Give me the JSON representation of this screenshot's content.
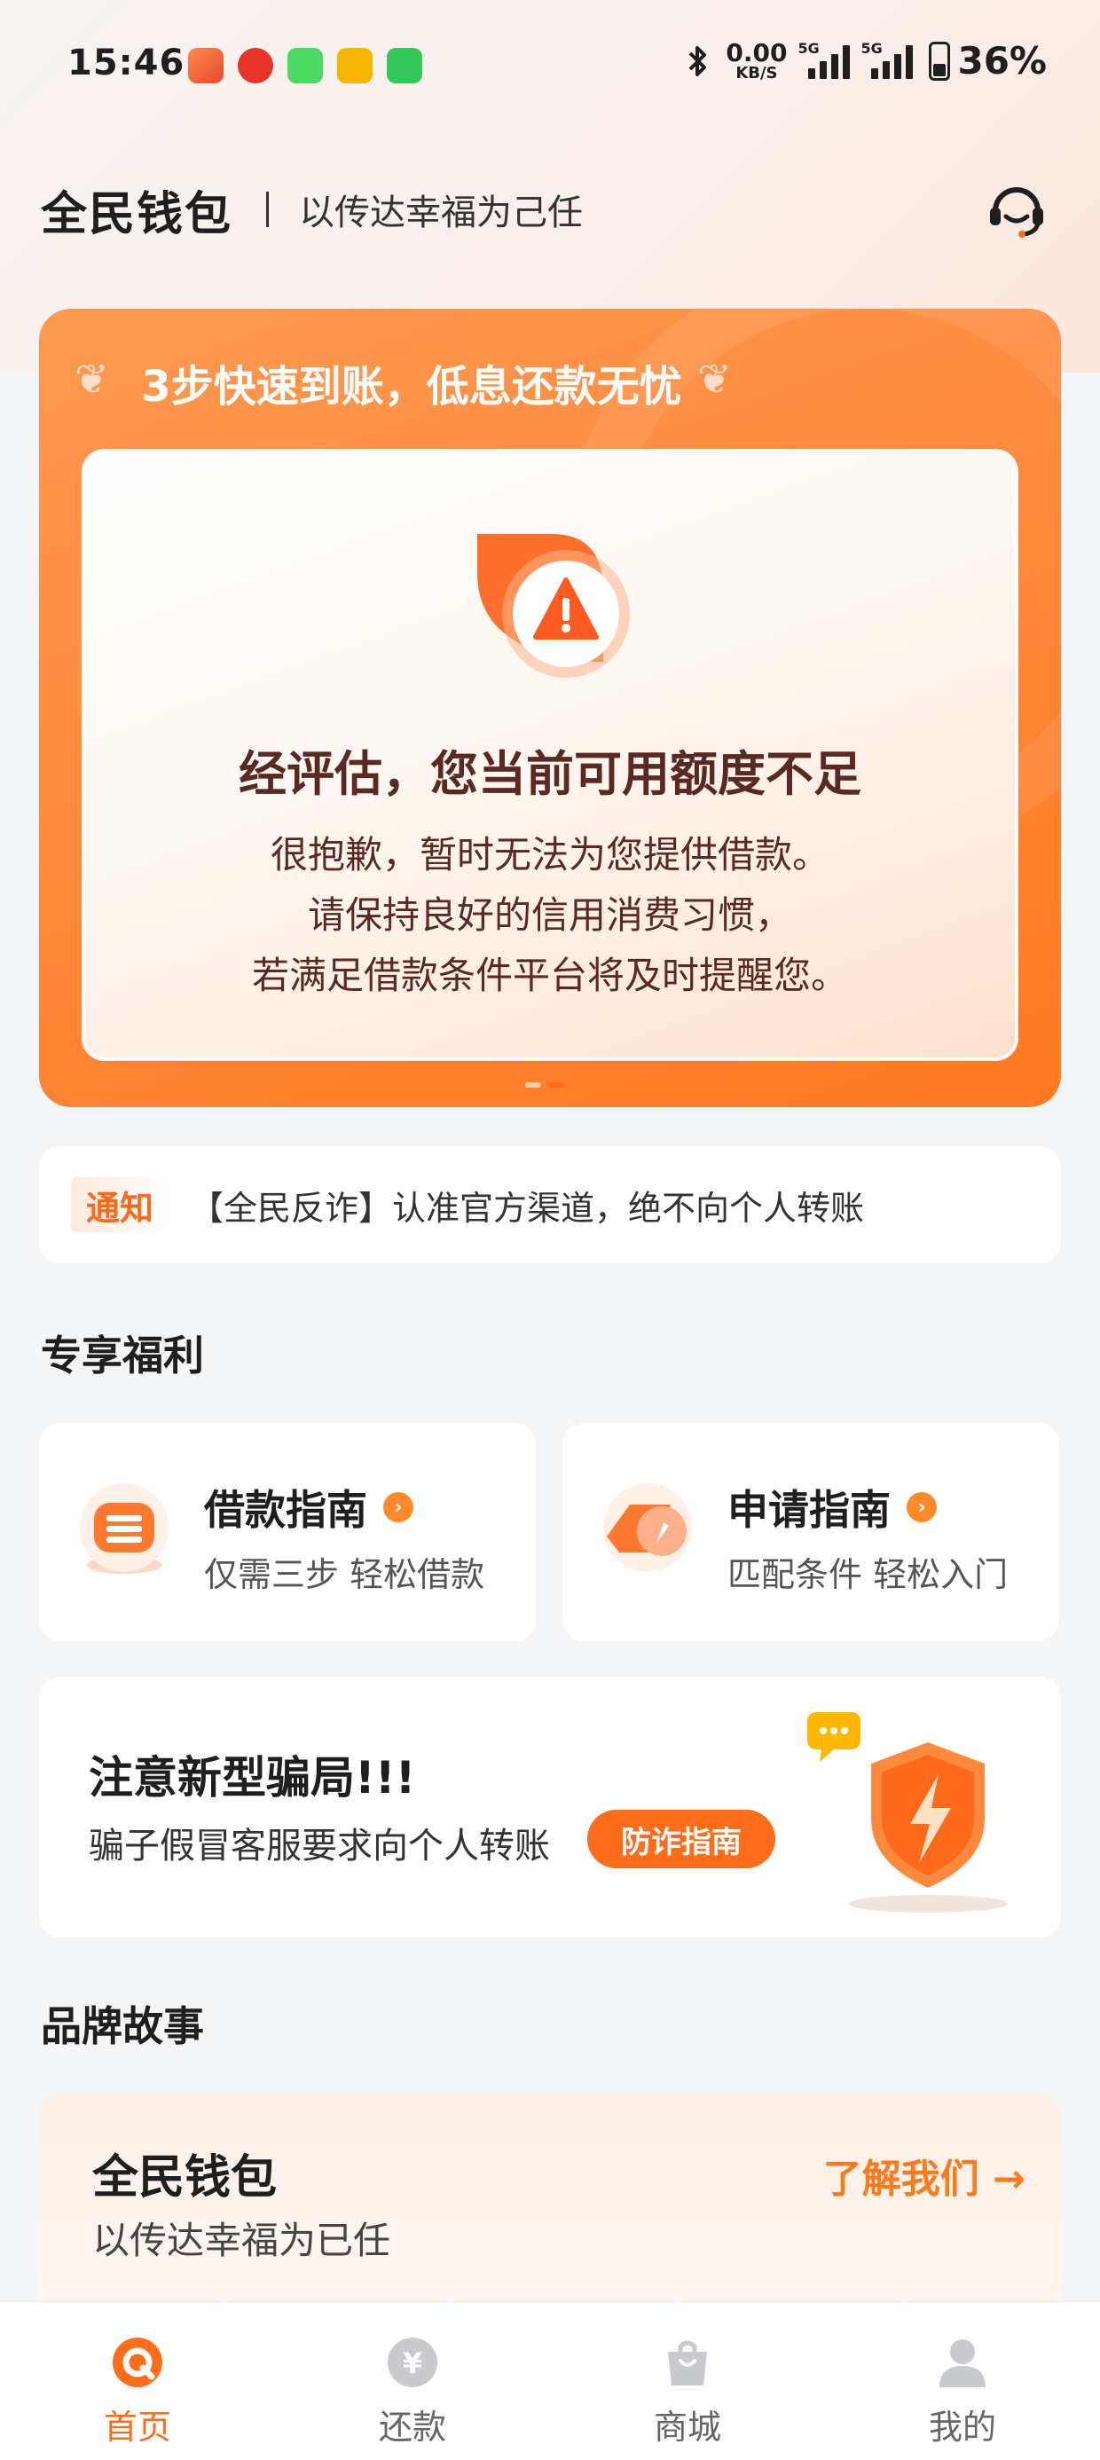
{
  "status_bar": {
    "time": "15:46",
    "net_speed_value": "0.00",
    "net_speed_unit": "KB/S",
    "signal_1": "5G",
    "signal_2": "5G",
    "battery": "36%",
    "app_icons": [
      "game-icon",
      "app-red-icon",
      "message-icon",
      "video-icon",
      "phone-icon"
    ],
    "icons": [
      "bluetooth-icon",
      "signal-icon",
      "battery-icon"
    ]
  },
  "header": {
    "brand": "全民钱包",
    "slogan": "以传达幸福为己任",
    "service_icon": "headset-icon"
  },
  "banner": {
    "title": "3步快速到账，低息还款无忧",
    "alert_icon": "warning-icon",
    "alert_title": "经评估，您当前可用额度不足",
    "alert_lines": [
      "很抱歉，暂时无法为您提供借款。",
      "请保持良好的信用消费习惯，",
      "若满足借款条件平台将及时提醒您。"
    ],
    "pages": 2,
    "active_page": 2
  },
  "notice": {
    "tag": "通知",
    "text": "【全民反诈】认准官方渠道，绝不向个人转账"
  },
  "benefits": {
    "title": "专享福利",
    "cards": [
      {
        "title": "借款指南",
        "subtitle": "仅需三步 轻松借款",
        "icon": "loan-guide-icon"
      },
      {
        "title": "申请指南",
        "subtitle": "匹配条件 轻松入门",
        "icon": "apply-guide-icon"
      }
    ]
  },
  "fraud": {
    "title": "注意新型骗局!!!",
    "subtitle": "骗子假冒客服要求向个人转账",
    "button": "防诈指南",
    "icon": "shield-icon"
  },
  "story": {
    "section_title": "品牌故事",
    "title": "全民钱包",
    "subtitle": "以传达幸福为已任",
    "link": "了解我们 →"
  },
  "tabbar": {
    "tabs": [
      {
        "label": "首页",
        "icon": "home-icon",
        "active": true
      },
      {
        "label": "还款",
        "icon": "repay-icon",
        "active": false
      },
      {
        "label": "商城",
        "icon": "shop-icon",
        "active": false
      },
      {
        "label": "我的",
        "icon": "profile-icon",
        "active": false
      }
    ]
  },
  "colors": {
    "accent": "#ff6c1a",
    "banner": "#ff8a3d",
    "alert_text": "#5a2a22"
  }
}
